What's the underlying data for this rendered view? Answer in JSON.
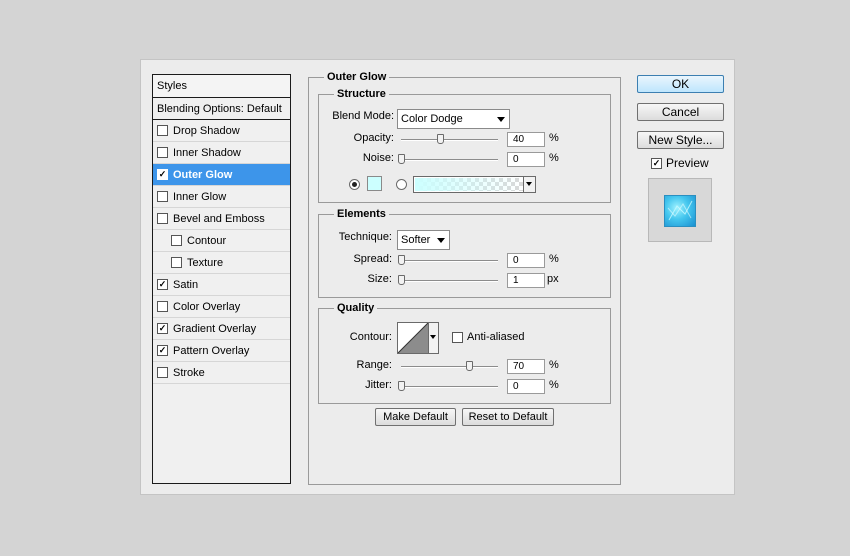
{
  "styles": {
    "header": "Styles",
    "blending_options": "Blending Options: Default",
    "items": [
      {
        "label": "Drop Shadow",
        "checked": false
      },
      {
        "label": "Inner Shadow",
        "checked": false
      },
      {
        "label": "Outer Glow",
        "checked": true,
        "selected": true
      },
      {
        "label": "Inner Glow",
        "checked": false
      },
      {
        "label": "Bevel and Emboss",
        "checked": false
      },
      {
        "label": "Contour",
        "checked": false,
        "indent": true
      },
      {
        "label": "Texture",
        "checked": false,
        "indent": true
      },
      {
        "label": "Satin",
        "checked": true
      },
      {
        "label": "Color Overlay",
        "checked": false
      },
      {
        "label": "Gradient Overlay",
        "checked": true
      },
      {
        "label": "Pattern Overlay",
        "checked": true
      },
      {
        "label": "Stroke",
        "checked": false
      }
    ]
  },
  "outer_glow": {
    "title": "Outer Glow",
    "structure": {
      "title": "Structure",
      "blend_mode_label": "Blend Mode:",
      "blend_mode_value": "Color Dodge",
      "opacity_label": "Opacity:",
      "opacity_value": "40",
      "opacity_level": 0.4,
      "noise_label": "Noise:",
      "noise_value": "0",
      "noise_level": 0,
      "percent": "%",
      "glow_color": "#ccffff"
    },
    "elements": {
      "title": "Elements",
      "technique_label": "Technique:",
      "technique_value": "Softer",
      "spread_label": "Spread:",
      "spread_value": "0",
      "spread_level": 0,
      "size_label": "Size:",
      "size_value": "1",
      "size_level": 0.004,
      "percent": "%",
      "px": "px"
    },
    "quality": {
      "title": "Quality",
      "contour_label": "Contour:",
      "anti_aliased_label": "Anti-aliased",
      "anti_aliased_checked": false,
      "range_label": "Range:",
      "range_value": "70",
      "range_level": 0.7,
      "jitter_label": "Jitter:",
      "jitter_value": "0",
      "jitter_level": 0,
      "percent": "%"
    },
    "make_default": "Make Default",
    "reset_to_default": "Reset to Default"
  },
  "buttons": {
    "ok": "OK",
    "cancel": "Cancel",
    "new_style": "New Style...",
    "preview_label": "Preview",
    "preview_checked": true
  }
}
